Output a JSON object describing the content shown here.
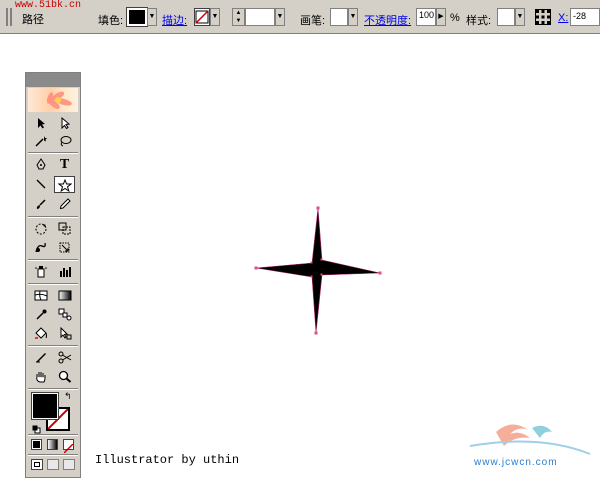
{
  "watermark_top": "www.51bk.cn",
  "control_bar": {
    "panel_label": "路径",
    "fill_label": "填色:",
    "stroke_label": "描边:",
    "brush_label": "画笔:",
    "opacity_label": "不透明度:",
    "opacity_value": "100",
    "opacity_unit": "%",
    "style_label": "样式:",
    "x_label": "X:",
    "x_value": "-28"
  },
  "toolbox": {
    "fill_color": "#000000",
    "stroke_color": "#ffffff",
    "tools": [
      "selection-icon",
      "direct-selection-icon",
      "magic-wand-icon",
      "lasso-icon",
      "pen-icon",
      "type-icon",
      "line-icon",
      "star-icon",
      "paintbrush-icon",
      "pencil-icon",
      "rotate-icon",
      "scale-icon",
      "warp-icon",
      "free-transform-icon",
      "symbol-sprayer-icon",
      "column-graph-icon",
      "mesh-icon",
      "gradient-icon",
      "eyedropper-icon",
      "blend-icon",
      "live-paint-bucket-icon",
      "live-paint-selection-icon",
      "slice-icon",
      "scissors-icon",
      "hand-icon",
      "zoom-icon"
    ],
    "type_glyph": "T"
  },
  "canvas": {
    "caption": "Illustrator by uthin",
    "logo_text": "www.jcwcn.com",
    "shape_fill": "#000000",
    "anchor_color": "#e0507a"
  }
}
